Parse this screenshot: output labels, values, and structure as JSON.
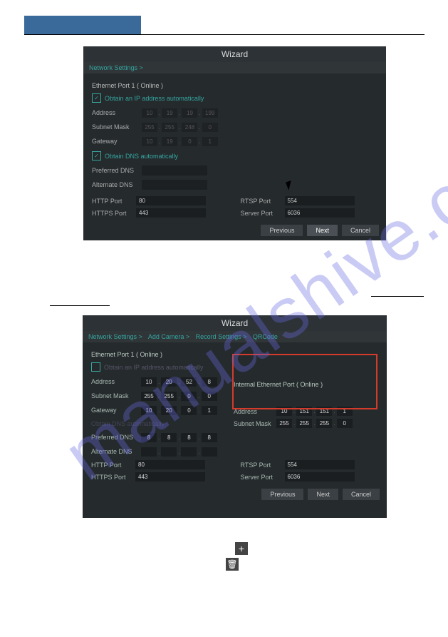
{
  "wizard1": {
    "title": "Wizard",
    "breadcrumb": [
      "Network Settings >"
    ],
    "section": "Ethernet Port 1 ( Online )",
    "dhcp_label": "Obtain an IP address automatically",
    "dhcp_checked": true,
    "fields": {
      "address_label": "Address",
      "address": [
        "10",
        "19",
        "19",
        "199"
      ],
      "subnet_label": "Subnet Mask",
      "subnet": [
        "255",
        "255",
        "248",
        "0"
      ],
      "gateway_label": "Gateway",
      "gateway": [
        "10",
        "19",
        "0",
        "1"
      ]
    },
    "dns_auto_label": "Obtain DNS automatically",
    "dns_auto_checked": true,
    "pref_dns_label": "Preferred DNS",
    "alt_dns_label": "Alternate DNS",
    "ports": {
      "http_label": "HTTP Port",
      "http": "80",
      "https_label": "HTTPS Port",
      "https": "443",
      "rtsp_label": "RTSP Port",
      "rtsp": "554",
      "server_label": "Server Port",
      "server": "6036"
    },
    "buttons": {
      "prev": "Previous",
      "next": "Next",
      "cancel": "Cancel"
    }
  },
  "wizard2": {
    "title": "Wizard",
    "breadcrumb": [
      "Network Settings >",
      "Add Camera >",
      "Record Settings >",
      "QRCode"
    ],
    "section": "Ethernet Port 1 ( Online )",
    "dhcp_label": "Obtain an IP address automatically",
    "dhcp_checked": false,
    "fields": {
      "address_label": "Address",
      "address": [
        "10",
        "20",
        "52",
        "8"
      ],
      "subnet_label": "Subnet Mask",
      "subnet": [
        "255",
        "255",
        "0",
        "0"
      ],
      "gateway_label": "Gateway",
      "gateway": [
        "10",
        "20",
        "0",
        "1"
      ]
    },
    "dns_auto_label": "Obtain DNS automatically",
    "pref_dns_label": "Preferred DNS",
    "pref_dns": [
      "8",
      "8",
      "8",
      "8"
    ],
    "alt_dns_label": "Alternate DNS",
    "alt_dns": [
      "",
      "",
      "",
      ""
    ],
    "internal_section": "Internal Ethernet Port ( Online )",
    "internal": {
      "address_label": "Address",
      "address": [
        "10",
        "151",
        "151",
        "1"
      ],
      "subnet_label": "Subnet Mask",
      "subnet": [
        "255",
        "255",
        "255",
        "0"
      ]
    },
    "ports": {
      "http_label": "HTTP Port",
      "http": "80",
      "https_label": "HTTPS Port",
      "https": "443",
      "rtsp_label": "RTSP Port",
      "rtsp": "554",
      "server_label": "Server Port",
      "server": "6036"
    },
    "buttons": {
      "prev": "Previous",
      "next": "Next",
      "cancel": "Cancel"
    }
  }
}
